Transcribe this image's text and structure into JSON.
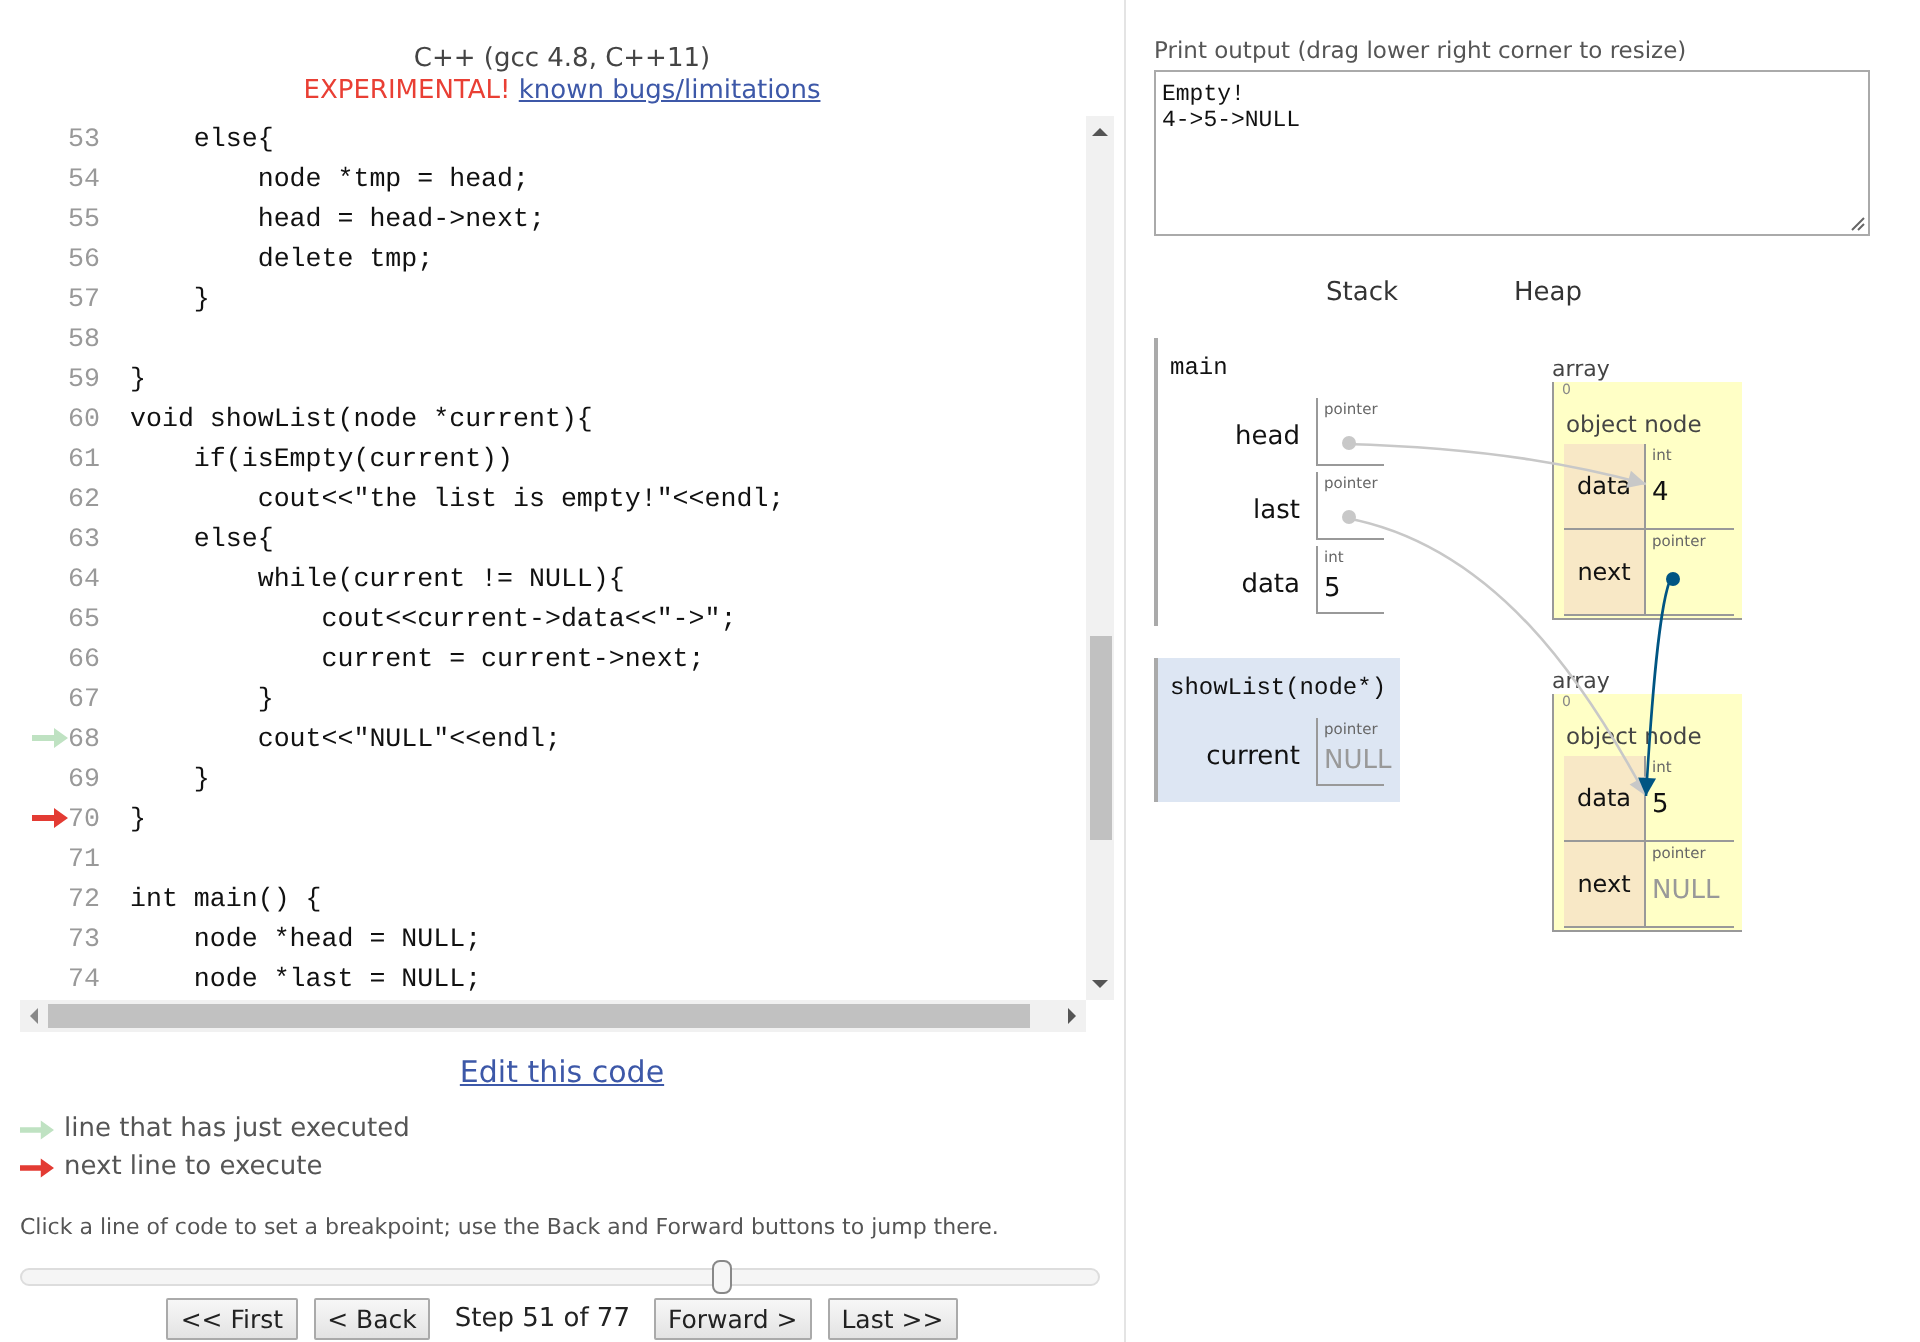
{
  "header": {
    "language": "C++ (gcc 4.8, C++11)",
    "warning": "EXPERIMENTAL!",
    "link": "known bugs/limitations"
  },
  "code": {
    "lines": [
      {
        "number": "53",
        "kind": "plain",
        "text": "    else{"
      },
      {
        "number": "54",
        "kind": "plain",
        "text": "        node *tmp = head;"
      },
      {
        "number": "55",
        "kind": "plain",
        "text": "        head = head->next;"
      },
      {
        "number": "56",
        "kind": "plain",
        "text": "        delete tmp;"
      },
      {
        "number": "57",
        "kind": "plain",
        "text": "    }"
      },
      {
        "number": "58",
        "kind": "plain"
      },
      {
        "number": "59",
        "kind": "plain",
        "text": "}"
      },
      {
        "number": "60",
        "kind": "plain",
        "text": "void showList(node *current){"
      },
      {
        "number": "61",
        "kind": "plain",
        "text": "    if(isEmpty(current))"
      },
      {
        "number": "62",
        "kind": "plain",
        "text": "        cout<<\"the list is empty!\"<<endl;"
      },
      {
        "number": "63",
        "kind": "plain",
        "text": "    else{"
      },
      {
        "number": "64",
        "kind": "plain",
        "text": "        while(current != NULL){"
      },
      {
        "number": "65",
        "kind": "plain",
        "text": "            cout<<current->data<<\"->\";"
      },
      {
        "number": "66",
        "kind": "plain",
        "text": "            current = current->next;"
      },
      {
        "number": "67",
        "kind": "plain",
        "text": "        }"
      },
      {
        "number": "68",
        "kind": "executed",
        "text": "        cout<<\"NULL\"<<endl;"
      },
      {
        "number": "69",
        "kind": "plain",
        "text": "    }"
      },
      {
        "number": "70",
        "kind": "next",
        "text": "}"
      },
      {
        "number": "71",
        "kind": "plain"
      },
      {
        "number": "72",
        "kind": "plain",
        "text": "int main() {"
      },
      {
        "number": "73",
        "kind": "plain",
        "text": "    node *head = NULL;"
      },
      {
        "number": "74",
        "kind": "plain",
        "text": "    node *last = NULL;"
      }
    ]
  },
  "edit_link": "Edit this code",
  "legend": [
    {
      "kind": "executed",
      "text": "line that has just executed"
    },
    {
      "kind": "next",
      "text": "next line to execute"
    }
  ],
  "hint": "Click a line of code to set a breakpoint; use the Back and Forward buttons to jump there.",
  "step_slider": {
    "level": 0.65
  },
  "navigation": {
    "back_buttons": [
      "<< First",
      "< Back"
    ],
    "step": "Step 51 of 77",
    "forward_buttons": [
      "Forward >",
      "Last >>"
    ]
  },
  "output": {
    "label": "Print output (drag lower right corner to resize)",
    "lines": [
      "Empty!",
      "4->5->NULL"
    ]
  },
  "stack_heading": "Stack",
  "heap_heading": "Heap",
  "frames": [
    {
      "name": "main",
      "active": false,
      "vars": [
        {
          "name": "head",
          "type": "pointer",
          "kind": "pointer"
        },
        {
          "name": "last",
          "type": "pointer",
          "kind": "pointer"
        },
        {
          "name": "data",
          "type": "int",
          "kind": "value",
          "value": "5"
        }
      ]
    },
    {
      "name": "showList(node*)",
      "active": true,
      "vars": [
        {
          "name": "current",
          "type": "pointer",
          "kind": "null",
          "value": "NULL"
        }
      ]
    }
  ],
  "heap": [
    {
      "label": "array",
      "index": "0",
      "type": "object node",
      "fields": [
        {
          "name": "data",
          "type": "int",
          "kind": "value",
          "value": "4"
        },
        {
          "name": "next",
          "type": "pointer",
          "kind": "pointer"
        }
      ]
    },
    {
      "label": "array",
      "index": "0",
      "type": "object node",
      "fields": [
        {
          "name": "data",
          "type": "int",
          "kind": "value",
          "value": "5"
        },
        {
          "name": "next",
          "type": "pointer",
          "kind": "null",
          "value": "NULL"
        }
      ]
    }
  ]
}
